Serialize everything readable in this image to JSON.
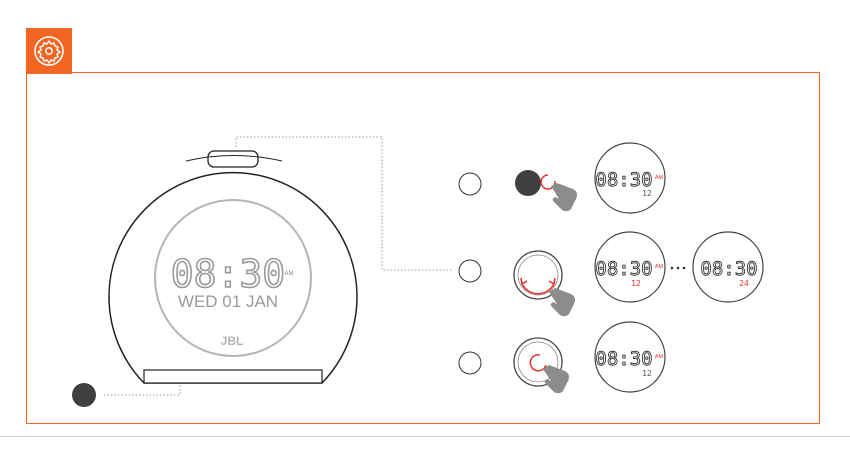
{
  "icon": "settings-gear-icon",
  "accent_color": "#f26522",
  "device": {
    "time": "08:30",
    "ampm": "AM",
    "date": "WED 01 JAN",
    "brand": "JBL"
  },
  "steps": [
    {
      "icon": "press-button-hand-icon",
      "display_time": "08:30",
      "display_ampm": "AM",
      "display_format": "12"
    },
    {
      "icon": "rotate-dial-hand-icon",
      "display_time": "08:30",
      "display_ampm": "AM",
      "display_format": "12",
      "alt_time": "08:30",
      "alt_format": "24"
    },
    {
      "icon": "press-dial-hand-icon",
      "display_time": "08:30",
      "display_ampm": "AM",
      "display_format": "12"
    }
  ]
}
